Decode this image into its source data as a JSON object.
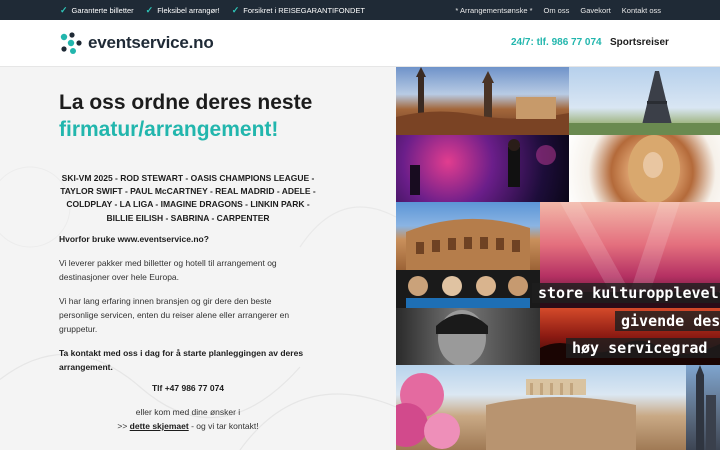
{
  "topbar": {
    "usps": [
      "Garanterte billetter",
      "Fleksibel arrangør!",
      "Forsikret i REISEGARANTIFONDET"
    ],
    "links": [
      "* Arrangementsønske *",
      "Om oss",
      "Gavekort",
      "Kontakt oss"
    ]
  },
  "header": {
    "logo_text": "eventservice.no",
    "phone": "24/7: tlf. 986 77 074",
    "sports_link": "Sportsreiser"
  },
  "hero": {
    "title_line1": "La oss ordne deres neste",
    "title_line2": "firmatur/arrangement!",
    "artists": "SKI-VM 2025 - ROD STEWART - OASIS  CHAMPIONS LEAGUE - TAYLOR SWIFT - PAUL McCARTNEY - REAL MADRID - ADELE - COLDPLAY -  LA LIGA - IMAGINE DRAGONS - LINKIN PARK - BILLIE EILISH - SABRINA - CARPENTER",
    "why_heading": "Hvorfor bruke www.eventservice.no?",
    "paragraph1": "Vi leverer pakker med billetter og hotell til arrangement og destinasjoner over hele Europa.",
    "paragraph2": "Vi har lang erfaring innen bransjen og gir dere den beste personlige servicen, enten du reiser alene eller arrangerer en gruppetur.",
    "contact_text": "Ta kontakt med oss i dag for å starte planleggingen av deres arrangement.",
    "tlf": "Tlf +47 986 77 074",
    "eller": "eller kom med dine ønsker i",
    "form_prefix": ">> ",
    "form_link": "dette skjemaet",
    "form_suffix": " - og vi tar kontakt!"
  },
  "collage": {
    "banner1": "store kulturopplevelser",
    "banner2": "givende destinasjoner",
    "banner3": "høy servicegrad"
  },
  "colors": {
    "accent": "#22b6ad",
    "topbar_bg": "#1f2a36"
  }
}
